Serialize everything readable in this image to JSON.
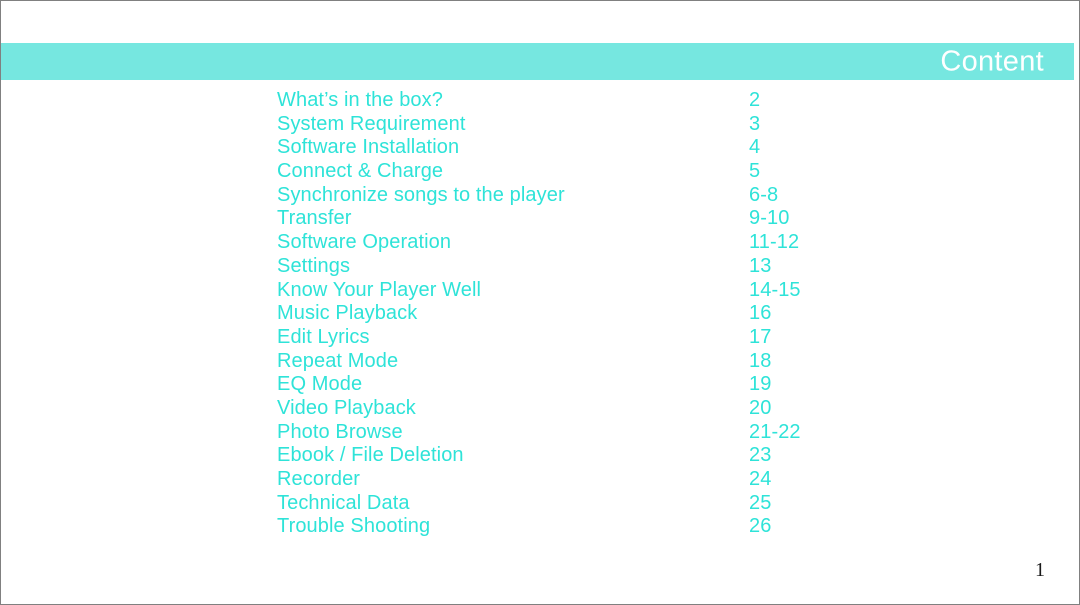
{
  "header": {
    "title": "Content",
    "band_color": "#76e7e0",
    "title_color": "#ffffff"
  },
  "theme": {
    "accent": "#2ee3d8",
    "band": "#76e7e0",
    "page_background": "#ffffff",
    "footer_text": "#1a1a1a"
  },
  "toc": {
    "entries": [
      {
        "label": "What’s in the box?",
        "page": "2"
      },
      {
        "label": "System Requirement",
        "page": "3"
      },
      {
        "label": "Software Installation",
        "page": "4"
      },
      {
        "label": "Connect & Charge",
        "page": "5"
      },
      {
        "label": "Synchronize songs to the player",
        "page": "6-8"
      },
      {
        "label": "Transfer",
        "page": "9-10"
      },
      {
        "label": "Software Operation",
        "page": "11-12"
      },
      {
        "label": "Settings",
        "page": "13"
      },
      {
        "label": "Know Your Player Well",
        "page": "14-15"
      },
      {
        "label": "Music Playback",
        "page": "16"
      },
      {
        "label": "Edit Lyrics",
        "page": "17"
      },
      {
        "label": "Repeat Mode",
        "page": "18"
      },
      {
        "label": "EQ Mode",
        "page": "19"
      },
      {
        "label": "Video Playback",
        "page": "20"
      },
      {
        "label": "Photo Browse",
        "page": "21-22"
      },
      {
        "label": "Ebook / File Deletion",
        "page": "23"
      },
      {
        "label": "Recorder",
        "page": "24"
      },
      {
        "label": "Technical Data",
        "page": "25"
      },
      {
        "label": "Trouble Shooting",
        "page": "26"
      }
    ]
  },
  "footer": {
    "page_number": "1"
  }
}
